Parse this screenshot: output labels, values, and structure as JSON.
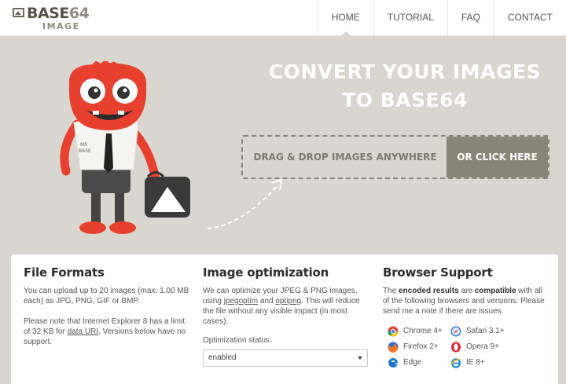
{
  "logo": {
    "title_bold": "BASE",
    "title_light": "64",
    "subtitle": "IMAGE"
  },
  "nav": {
    "items": [
      {
        "label": "HOME",
        "active": true
      },
      {
        "label": "TUTORIAL"
      },
      {
        "label": "FAQ"
      },
      {
        "label": "CONTACT"
      }
    ]
  },
  "hero": {
    "title_line1": "CONVERT YOUR IMAGES",
    "title_line2": "TO BASE64",
    "mascot_badge_line1": "MR",
    "mascot_badge_line2": "BASE"
  },
  "dropzone": {
    "text": "DRAG & DROP IMAGES ANYWHERE",
    "button_label": "OR CLICK HERE"
  },
  "file_formats": {
    "title": "File Formats",
    "para1": "You can upload up to 20 images (max. 1.00 MB each) as JPG, PNG, GIF or BMP.",
    "para2_before": "Please note that Internet Explorer 8 has a limit of 32 KB for ",
    "para2_link": "data URI",
    "para2_after": ". Versions below have no support."
  },
  "optimization": {
    "title": "Image optimization",
    "text_before": "We can optimize your JPEG & PNG images, using ",
    "link1": "jpegoptim",
    "text_mid": " and ",
    "link2": "optipng",
    "text_after": ". This will reduce the file without any visible impact (in most cases).",
    "status_label": "Optimization status:",
    "status_value": "enabled"
  },
  "browser_support": {
    "title": "Browser Support",
    "text_1": "The ",
    "bold_1": "encoded results",
    "text_2": " are ",
    "bold_2": "compatible",
    "text_3": " with all of the following browsers and versions. Please send me a note if there are issues.",
    "browsers": [
      {
        "name": "Chrome 4+",
        "icon": "chrome-icon"
      },
      {
        "name": "Safari 3.1+",
        "icon": "safari-icon"
      },
      {
        "name": "Firefox 2+",
        "icon": "firefox-icon"
      },
      {
        "name": "Opera 9+",
        "icon": "opera-icon"
      },
      {
        "name": "Edge",
        "icon": "edge-icon"
      },
      {
        "name": "IE 8+",
        "icon": "ie-icon"
      }
    ]
  },
  "colors": {
    "background": "#d8d6cf",
    "accent_button": "#888576",
    "mascot_red": "#e8402e",
    "text_dark": "#333333"
  }
}
